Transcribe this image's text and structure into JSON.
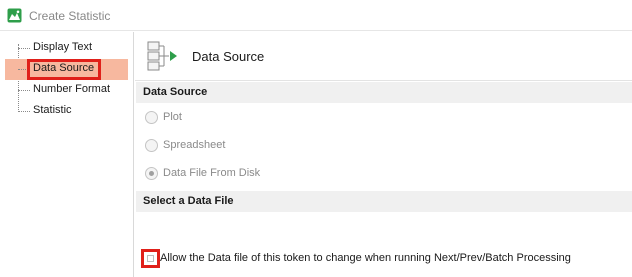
{
  "window": {
    "title": "Create Statistic",
    "app_icon": "chart-mountain-icon"
  },
  "tree": {
    "items": [
      {
        "label": "Display Text",
        "selected": false
      },
      {
        "label": "Data Source",
        "selected": true
      },
      {
        "label": "Number Format",
        "selected": false
      },
      {
        "label": "Statistic",
        "selected": false
      }
    ]
  },
  "panel": {
    "icon": "data-source-icon",
    "title": "Data Source",
    "data_source_section": "Data Source",
    "options": [
      {
        "label": "Plot",
        "checked": false,
        "enabled": false
      },
      {
        "label": "Spreadsheet",
        "checked": false,
        "enabled": false
      },
      {
        "label": "Data File From Disk",
        "checked": true,
        "enabled": false
      }
    ],
    "select_file_section": "Select a Data File",
    "allow_change_label": "Allow the Data file of this token to change when running Next/Prev/Batch Processing",
    "allow_change_checked": false
  },
  "colors": {
    "selection_bg": "#f7b89f",
    "highlight_border": "#e0201a",
    "section_bg": "#f0f0f0",
    "icon_green": "#2e9e4a"
  }
}
